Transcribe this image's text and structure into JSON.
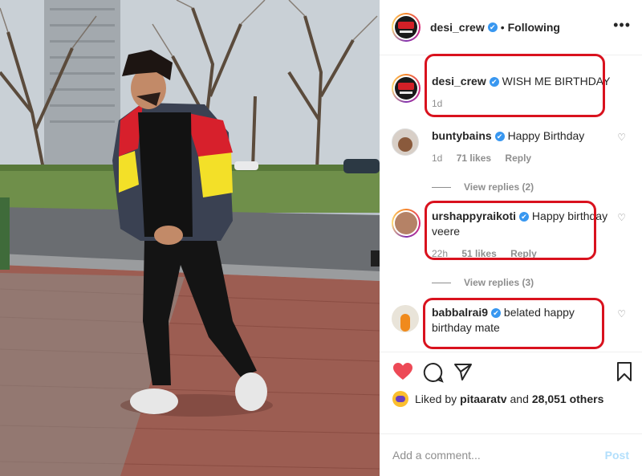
{
  "post": {
    "author": "desi_crew",
    "follow_state": "Following"
  },
  "icons": {
    "verified": "✔",
    "more": "•••",
    "like_small": "♡"
  },
  "caption": {
    "user": "desi_crew",
    "text": "WISH ME BIRTHDAY",
    "time": "1d"
  },
  "comments": [
    {
      "user": "buntybains",
      "text": "Happy Birthday",
      "time": "1d",
      "likes": "71 likes",
      "reply": "Reply",
      "view_replies": "View replies (2)"
    },
    {
      "user": "urshappyraikoti",
      "text": "Happy birthday veere",
      "time": "22h",
      "likes": "51 likes",
      "reply": "Reply",
      "view_replies": "View replies (3)"
    },
    {
      "user": "babbalrai9",
      "text": "belated happy birthday mate"
    }
  ],
  "likes": {
    "prefix": "Liked by",
    "user": "pitaaratv",
    "middle": "and",
    "count": "28,051 others"
  },
  "add_comment": {
    "placeholder": "Add a comment...",
    "post_label": "Post"
  },
  "colors": {
    "accent": "#3897f0",
    "like_red": "#ed4956",
    "highlight_red": "#d9121e"
  }
}
